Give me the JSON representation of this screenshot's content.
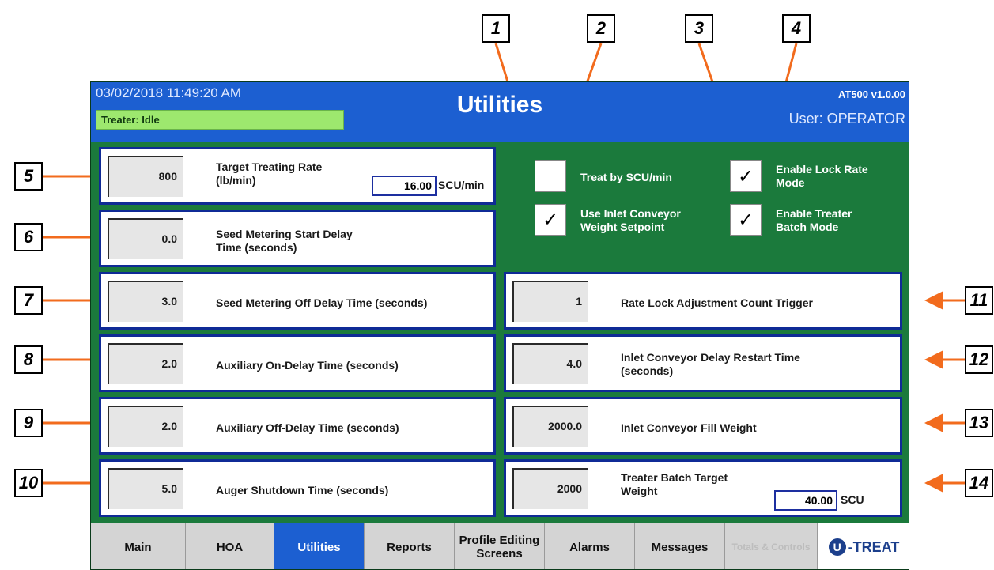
{
  "header": {
    "datetime": "03/02/2018 11:49:20 AM",
    "status": "Treater: Idle",
    "title": "Utilities",
    "version": "AT500 v1.0.00",
    "user": "User: OPERATOR"
  },
  "left_panels": [
    {
      "value": "800",
      "label_line1": "Target Treating Rate",
      "label_line2": "(lb/min)",
      "input_value": "16.00",
      "unit": "SCU/min"
    },
    {
      "value": "0.0",
      "label_line1": "Seed Metering Start Delay",
      "label_line2": "Time (seconds)"
    },
    {
      "value": "3.0",
      "label_line1": "Seed Metering Off Delay Time (seconds)"
    },
    {
      "value": "2.0",
      "label_line1": "Auxiliary On-Delay Time (seconds)"
    },
    {
      "value": "2.0",
      "label_line1": "Auxiliary Off-Delay Time (seconds)"
    },
    {
      "value": "5.0",
      "label_line1": "Auger Shutdown Time (seconds)"
    }
  ],
  "right_panels": [
    {
      "value": "1",
      "label_line1": "Rate Lock Adjustment Count Trigger"
    },
    {
      "value": "4.0",
      "label_line1": "Inlet Conveyor Delay Restart Time",
      "label_line2": "(seconds)"
    },
    {
      "value": "2000.0",
      "label_line1": "Inlet Conveyor Fill Weight"
    },
    {
      "value": "2000",
      "label_line1": "Treater Batch Target",
      "label_line2": "Weight",
      "input_value": "40.00",
      "unit": "SCU"
    }
  ],
  "checkboxes": [
    {
      "label_line1": "Treat by SCU/min",
      "checked": false,
      "mark": ""
    },
    {
      "label_line1": "Use Inlet Conveyor",
      "label_line2": "Weight Setpoint",
      "checked": true,
      "mark": "✓"
    },
    {
      "label_line1": "Enable Lock Rate",
      "label_line2": "Mode",
      "checked": true,
      "mark": "✓"
    },
    {
      "label_line1": "Enable Treater",
      "label_line2": "Batch Mode",
      "checked": true,
      "mark": "✓"
    }
  ],
  "nav": {
    "tabs": [
      {
        "label": "Main"
      },
      {
        "label": "HOA"
      },
      {
        "label": "Utilities",
        "active": true
      },
      {
        "label": "Reports"
      },
      {
        "label": "Profile Editing Screens"
      },
      {
        "label": "Alarms"
      },
      {
        "label": "Messages"
      },
      {
        "label": "Totals & Controls",
        "disabled": true
      }
    ],
    "logo_mark": "U",
    "logo_text": "-TREAT"
  },
  "callouts": [
    "1",
    "2",
    "3",
    "4",
    "5",
    "6",
    "7",
    "8",
    "9",
    "10",
    "11",
    "12",
    "13",
    "14"
  ],
  "colors": {
    "header_blue": "#1c5fd1",
    "background_green": "#1b7a3c",
    "status_green": "#9de86e",
    "panel_border": "#0f2a96",
    "arrow_orange": "#f26b1d"
  },
  "icons": [
    "checkmark-icon",
    "u-treat-logo-icon"
  ]
}
